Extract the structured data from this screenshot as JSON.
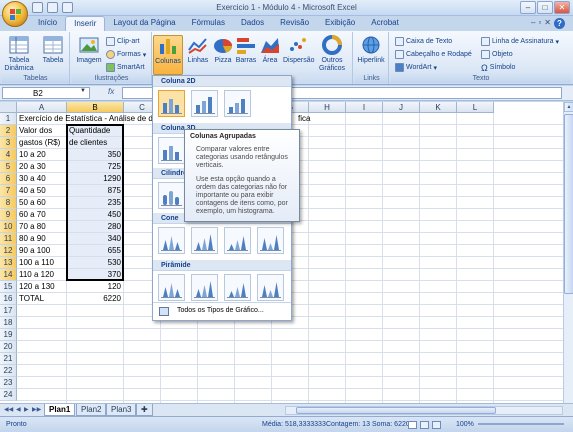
{
  "window": {
    "title": "Exercicio 1 - Módulo 4 - Microsoft Excel",
    "min": "–",
    "max": "□",
    "close": "✕"
  },
  "tabs": [
    "Início",
    "Inserir",
    "Layout da Página",
    "Fórmulas",
    "Dados",
    "Revisão",
    "Exibição",
    "Acrobat"
  ],
  "ribbon": {
    "tabelas": {
      "label": "Tabelas",
      "tabela_dinamica": "Tabela Dinâmica",
      "tabela": "Tabela"
    },
    "ilustracoes": {
      "label": "Ilustrações",
      "imagem": "Imagem",
      "clipart": "Clip-art",
      "formas": "Formas",
      "smartart": "SmartArt"
    },
    "graficos": {
      "colunas": "Colunas",
      "linhas": "Linhas",
      "pizza": "Pizza",
      "barras": "Barras",
      "area": "Área",
      "dispersao": "Dispersão",
      "outros": "Outros Gráficos"
    },
    "links": {
      "label": "Links",
      "hiperlink": "Hiperlink"
    },
    "texto": {
      "label": "Texto",
      "caixa_texto": "Caixa de Texto",
      "cabecalho": "Cabeçalho e Rodapé",
      "wordart": "WordArt",
      "linha_assinatura": "Linha de Assinatura",
      "objeto": "Objeto",
      "simbolo": "Símbolo"
    }
  },
  "formula_bar": {
    "name_box": "B2",
    "fx": "fx",
    "value": ""
  },
  "columns": [
    "A",
    "B",
    "C",
    "D",
    "E",
    "F",
    "G",
    "H",
    "I",
    "J",
    "K",
    "L"
  ],
  "rows": [
    "1",
    "2",
    "3",
    "4",
    "5",
    "6",
    "7",
    "8",
    "9",
    "10",
    "11",
    "12",
    "13",
    "14",
    "15",
    "16",
    "17",
    "18",
    "19",
    "20",
    "21",
    "22",
    "23",
    "24"
  ],
  "sheet": {
    "title_cell": "Exercício de Estatística - Análise de dados utilizando um gráfico",
    "title_tail": "fica",
    "header_a": [
      "Valor dos",
      "gastos (R$)"
    ],
    "header_b": [
      "Quantidade",
      "de clientes"
    ],
    "data": [
      {
        "range": "10 a 20",
        "qty": "350"
      },
      {
        "range": "20 a 30",
        "qty": "725"
      },
      {
        "range": "30 a 40",
        "qty": "1290"
      },
      {
        "range": "40 a 50",
        "qty": "875"
      },
      {
        "range": "50 a 60",
        "qty": "235"
      },
      {
        "range": "60 a 70",
        "qty": "450"
      },
      {
        "range": "70 a 80",
        "qty": "280"
      },
      {
        "range": "80 a 90",
        "qty": "340"
      },
      {
        "range": "90 a 100",
        "qty": "655"
      },
      {
        "range": "100 a 110",
        "qty": "530"
      },
      {
        "range": "110 a 120",
        "qty": "370"
      },
      {
        "range": "120 a 130",
        "qty": "120"
      }
    ],
    "total_label": "TOTAL",
    "total_value": "6220"
  },
  "gallery": {
    "sections": [
      "Coluna 2D",
      "Coluna 3D",
      "Cilindro",
      "Cone",
      "Pirâmide"
    ],
    "footer": "Todos os Tipos de Gráfico..."
  },
  "tooltip": {
    "title": "Colunas Agrupadas",
    "p1": "Comparar valores entre categorias usando retângulos verticais.",
    "p2": "Use esta opção quando a ordem das categorias não for importante ou para exibir contagens de itens como, por exemplo, um histograma."
  },
  "sheet_tabs": [
    "Plan1",
    "Plan2",
    "Plan3"
  ],
  "status": {
    "ready": "Pronto",
    "media": "Média: 518,3333333",
    "contagem": "Contagem: 13",
    "soma": "Soma: 6220",
    "zoom": "100%"
  }
}
